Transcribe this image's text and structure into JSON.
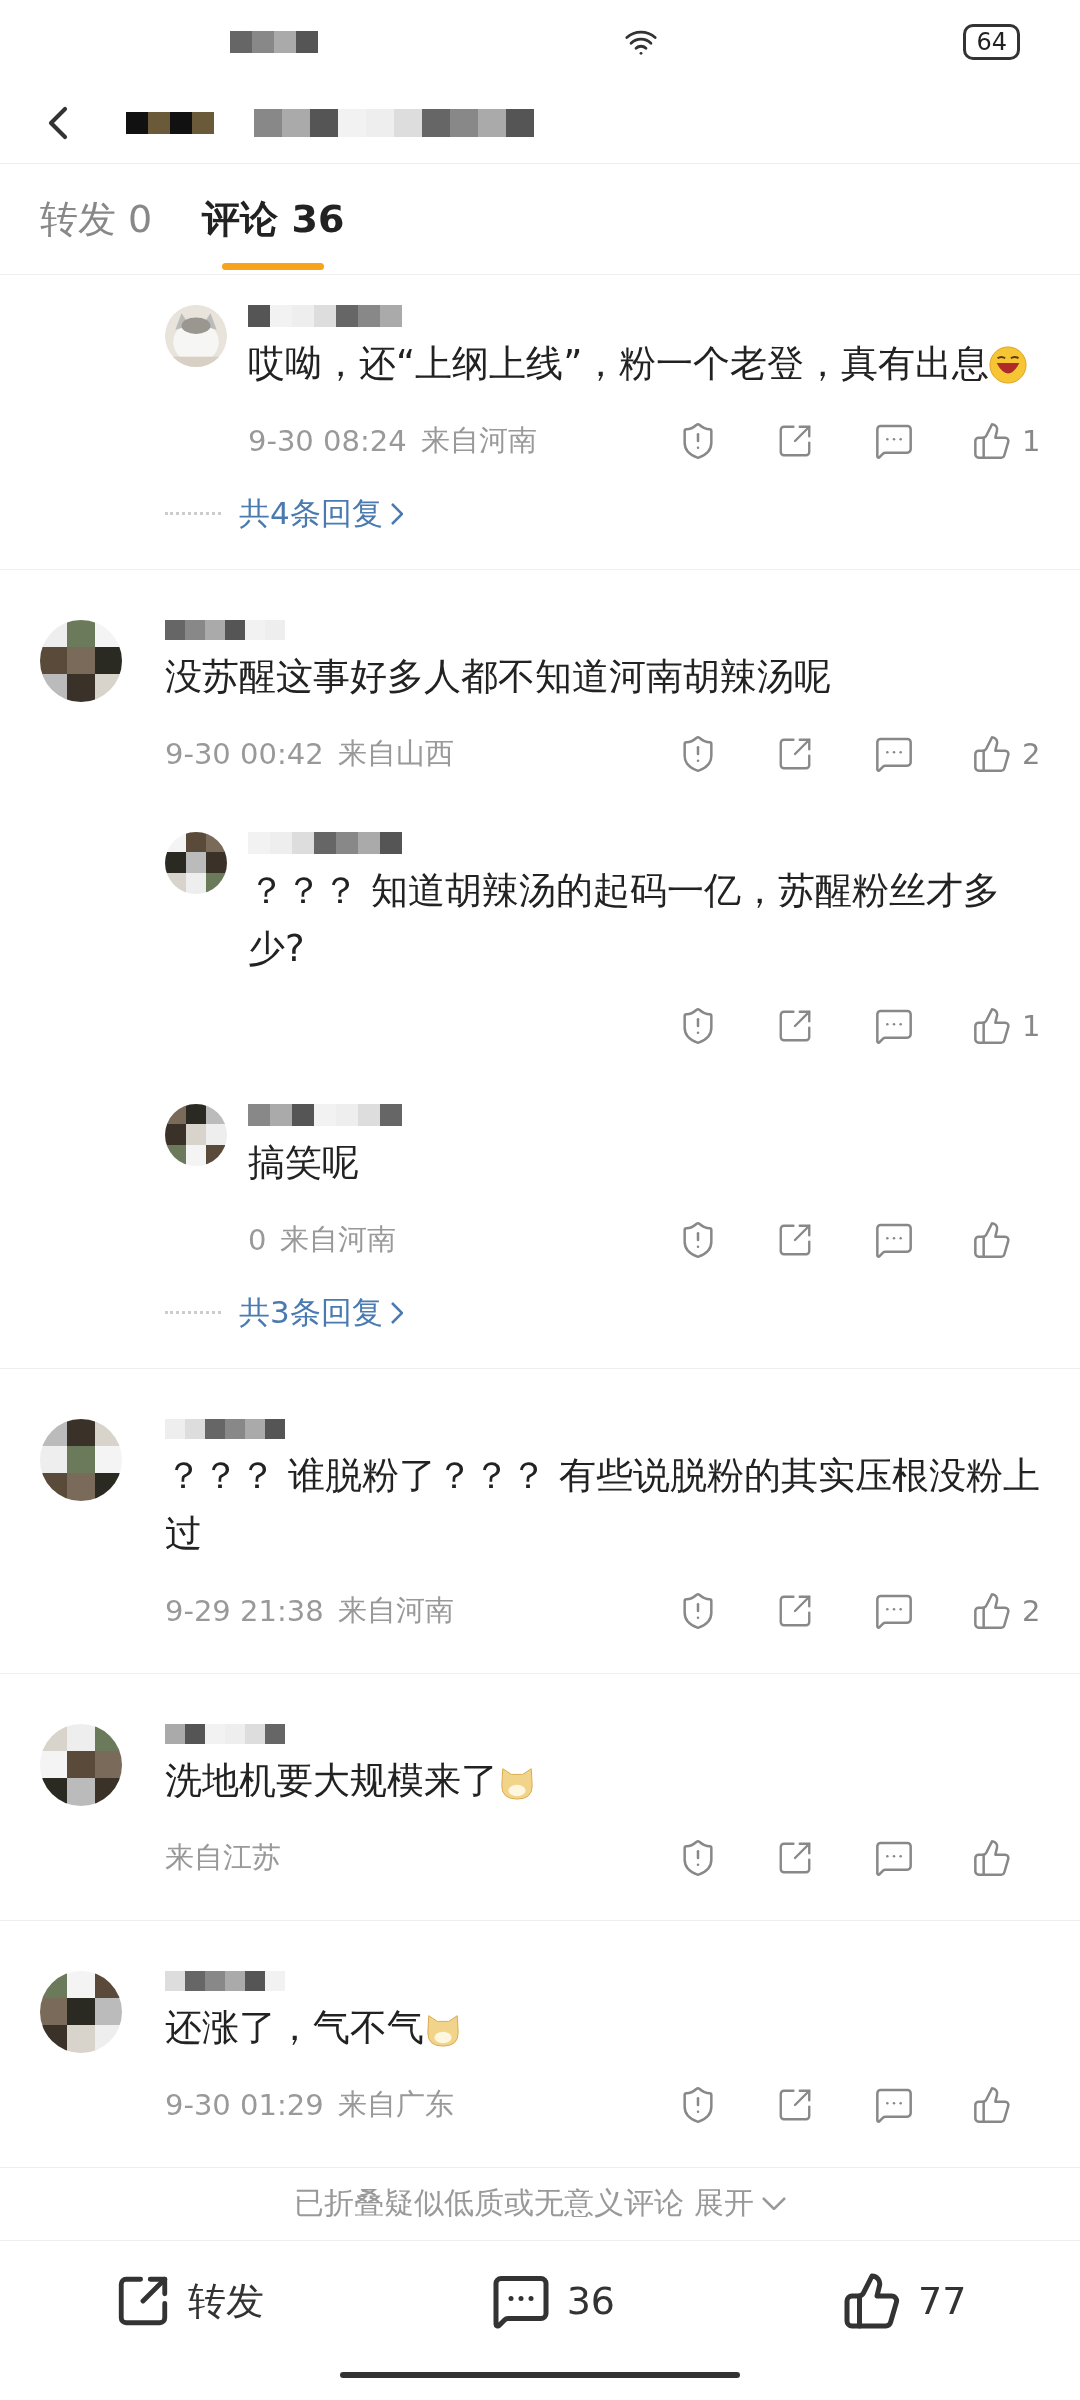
{
  "status_bar": {
    "battery": "64"
  },
  "tabs": [
    {
      "label": "转发 0",
      "selected": false
    },
    {
      "label": "评论 36",
      "selected": true
    }
  ],
  "threads": [
    {
      "replies": [
        {
          "text": "哎呦，还“上纲上线”，粉一个老登，真有出息",
          "emoji": {
            "kind": "laugh"
          },
          "time": "9-30 08:24",
          "location": "来自河南",
          "likes": "1"
        }
      ],
      "more": "共4条回复"
    },
    {
      "comment": {
        "avatar": {
          "kind": "mosaic"
        },
        "text": "没苏醒这事好多人都不知道河南胡辣汤呢",
        "time": "9-30 00:42",
        "location": "来自山西",
        "likes": "2"
      },
      "replies": [
        {
          "avatar": {
            "kind": "mosaic"
          },
          "text": "？？？ 知道胡辣汤的起码一亿，苏醒粉丝才多少?",
          "likes": "1"
        },
        {
          "avatar": {
            "kind": "mosaic"
          },
          "text": "搞笑呢",
          "time": "0",
          "location": "来自河南"
        }
      ],
      "more": "共3条回复"
    },
    {
      "comment": {
        "avatar": {
          "kind": "mosaic"
        },
        "text": "？？？ 谁脱粉了？？？ 有些说脱粉的其实压根没粉上过",
        "time": "9-29 21:38",
        "location": "来自河南",
        "likes": "2"
      }
    },
    {
      "comment": {
        "avatar": {
          "kind": "mosaic"
        },
        "text": "洗地机要大规模来了",
        "emoji": {
          "kind": "dog"
        },
        "location": "来自江苏"
      }
    },
    {
      "comment": {
        "avatar": {
          "kind": "mosaic"
        },
        "text": "还涨了，气不气",
        "emoji": {
          "kind": "dog"
        },
        "time": "9-30 01:29",
        "location": "来自广东"
      }
    }
  ],
  "folded": {
    "text": "已折叠疑似低质或无意义评论",
    "action": "展开"
  },
  "bottom_bar": [
    {
      "kind": "share",
      "label": "转发"
    },
    {
      "kind": "comment",
      "label": "36"
    },
    {
      "kind": "like",
      "label": "77"
    }
  ]
}
